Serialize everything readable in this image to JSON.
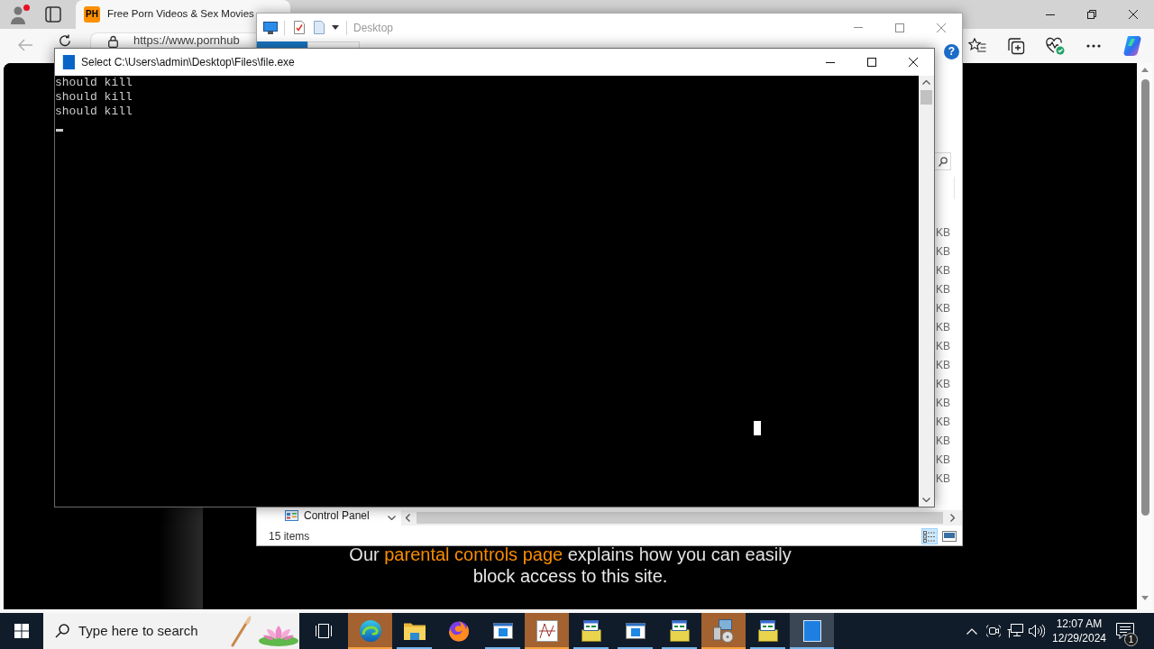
{
  "browser": {
    "tab": {
      "favicon": "PH",
      "title": "Free Porn Videos & Sex Movies"
    },
    "address": "https://www.pornhub",
    "page": {
      "notice_start": "Our ",
      "notice_link": "parental controls page",
      "notice_end": " explains how you can easily block access to this site."
    }
  },
  "explorer": {
    "title": "Desktop",
    "help": "?",
    "size_cells": [
      "KB",
      "KB",
      "KB",
      "KB",
      "KB",
      "KB",
      "KB",
      "KB",
      "KB",
      "KB",
      "KB",
      "KB",
      "KB",
      "KB"
    ],
    "nav_item": "Control Panel",
    "status": "15 items",
    "views": [
      {
        "kind": "details",
        "selected": true
      },
      {
        "kind": "preview",
        "selected": false
      }
    ]
  },
  "console": {
    "title": "Select C:\\Users\\admin\\Desktop\\Files\\file.exe",
    "lines": [
      "should kill",
      "should kill",
      "should kill"
    ]
  },
  "taskbar": {
    "search_placeholder": "Type here to search",
    "apps": [
      {
        "kind": "edge",
        "open": true,
        "flashing": true,
        "active": false
      },
      {
        "kind": "folder",
        "open": true,
        "flashing": false,
        "active": false
      },
      {
        "kind": "firefox",
        "open": false,
        "flashing": false,
        "active": false
      },
      {
        "kind": "app-window",
        "open": true,
        "flashing": false,
        "active": false
      },
      {
        "kind": "sketch",
        "open": true,
        "flashing": true,
        "active": false
      },
      {
        "kind": "installer",
        "open": true,
        "flashing": false,
        "active": false
      },
      {
        "kind": "app-window",
        "open": true,
        "flashing": false,
        "active": false
      },
      {
        "kind": "installer",
        "open": true,
        "flashing": false,
        "active": false
      },
      {
        "kind": "setup",
        "open": true,
        "flashing": true,
        "active": false
      },
      {
        "kind": "installer",
        "open": true,
        "flashing": false,
        "active": false
      },
      {
        "kind": "console-window",
        "open": true,
        "flashing": false,
        "active": true
      }
    ],
    "time": "12:07 AM",
    "date": "12/29/2024",
    "notifications": "1"
  }
}
